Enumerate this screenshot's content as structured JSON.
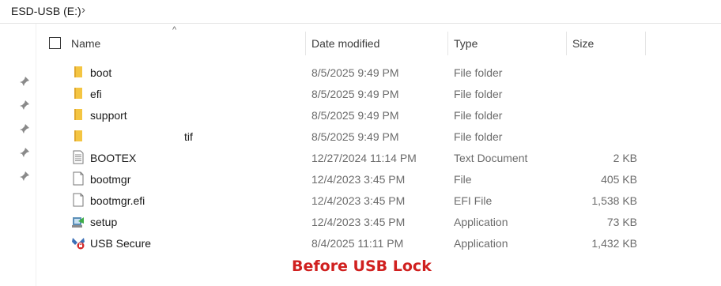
{
  "breadcrumb": {
    "location": "ESD-USB (E:)",
    "chevron": "›"
  },
  "columns": {
    "name": "Name",
    "date": "Date modified",
    "type": "Type",
    "size": "Size",
    "sort_indicator": "^"
  },
  "files": [
    {
      "name": "boot",
      "date": "8/5/2025 9:49 PM",
      "type": "File folder",
      "size": "",
      "icon": "folder-icon"
    },
    {
      "name": "efi",
      "date": "8/5/2025 9:49 PM",
      "type": "File folder",
      "size": "",
      "icon": "folder-icon"
    },
    {
      "name": "support",
      "date": "8/5/2025 9:49 PM",
      "type": "File folder",
      "size": "",
      "icon": "folder-icon"
    },
    {
      "name": "tif",
      "date": "8/5/2025 9:49 PM",
      "type": "File folder",
      "size": "",
      "icon": "folder-icon"
    },
    {
      "name": "BOOTEX",
      "date": "12/27/2024 11:14 PM",
      "type": "Text Document",
      "size": "2 KB",
      "icon": "text-document-icon"
    },
    {
      "name": "bootmgr",
      "date": "12/4/2023 3:45 PM",
      "type": "File",
      "size": "405 KB",
      "icon": "file-icon"
    },
    {
      "name": "bootmgr.efi",
      "date": "12/4/2023 3:45 PM",
      "type": "EFI File",
      "size": "1,538 KB",
      "icon": "file-icon"
    },
    {
      "name": "setup",
      "date": "12/4/2023 3:45 PM",
      "type": "Application",
      "size": "73 KB",
      "icon": "setup-app-icon"
    },
    {
      "name": "USB Secure",
      "date": "8/4/2025 11:11 PM",
      "type": "Application",
      "size": "1,432 KB",
      "icon": "usb-secure-app-icon"
    }
  ],
  "caption": "Before USB Lock",
  "colors": {
    "caption": "#d0201f",
    "folder": "#f4c542",
    "folder_dark": "#e0a82e"
  }
}
